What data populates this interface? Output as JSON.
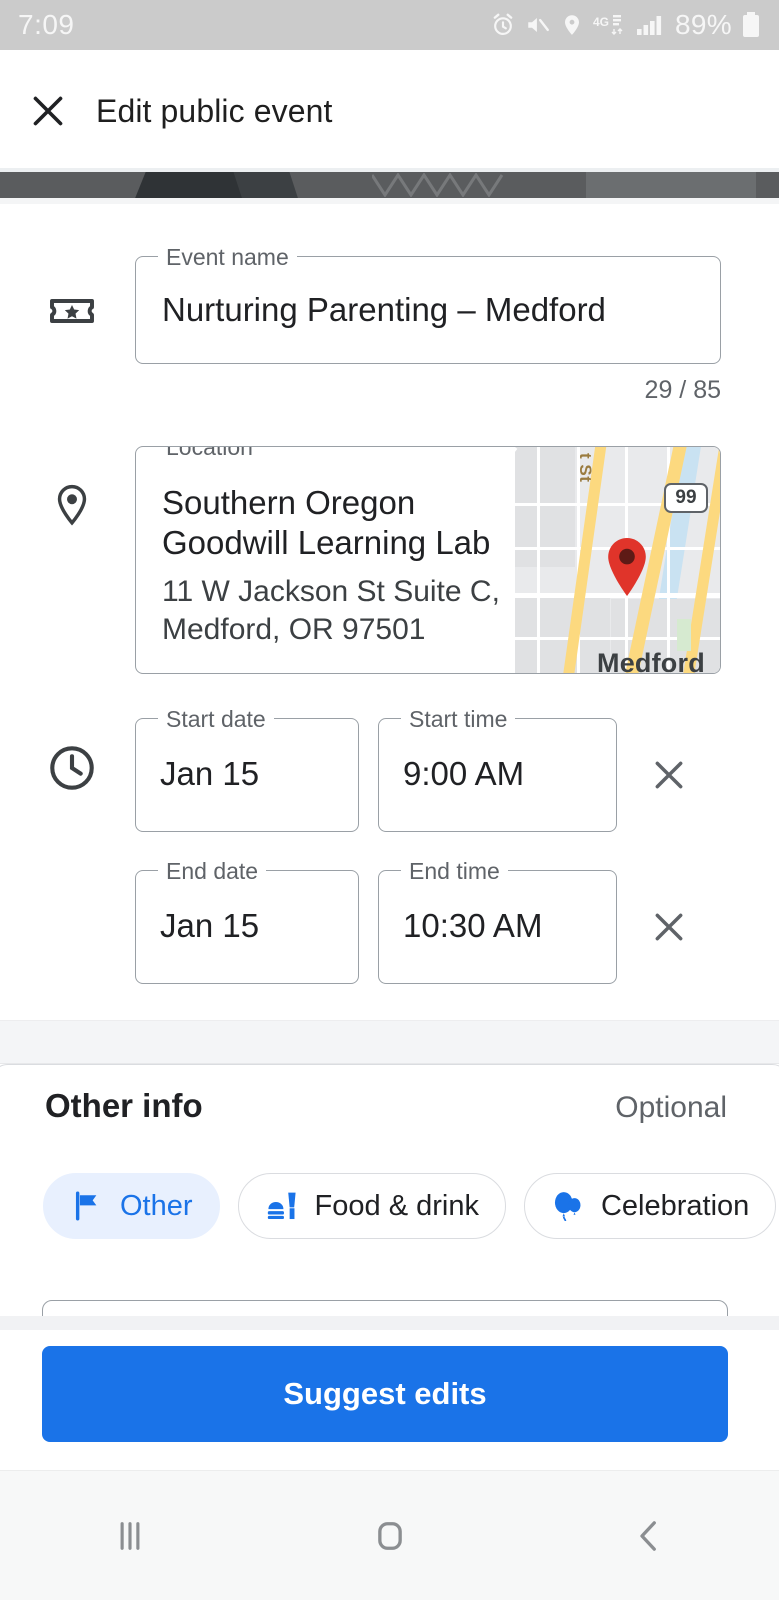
{
  "status_bar": {
    "time": "7:09",
    "battery_percent": "89%",
    "icons": [
      "alarm-icon",
      "mute-icon",
      "location-icon",
      "4g-lte-icon",
      "signal-bars-icon",
      "battery-icon"
    ]
  },
  "app_bar": {
    "close_label": "×",
    "title": "Edit public event",
    "close_icon": "close-icon"
  },
  "form": {
    "event_name": {
      "label": "Event name",
      "value": "Nurturing Parenting – Medford",
      "counter": "29 / 85",
      "icon": "ticket-icon"
    },
    "location": {
      "label": "Location",
      "name": "Southern Oregon Goodwill Learning Lab",
      "address": "11 W Jackson St Suite C, Medford, OR 97501",
      "icon": "location-pin-icon",
      "map": {
        "street_label": "t St",
        "highway_shield": "99",
        "city_label": "Medford",
        "marker_color": "#e0342a",
        "road_color": "#fcd97f"
      }
    },
    "schedule": {
      "icon": "clock-icon",
      "start_date": {
        "label": "Start date",
        "value": "Jan 15"
      },
      "start_time": {
        "label": "Start time",
        "value": "9:00 AM"
      },
      "end_date": {
        "label": "End date",
        "value": "Jan 15"
      },
      "end_time": {
        "label": "End time",
        "value": "10:30 AM"
      },
      "clear_icon": "close-icon"
    }
  },
  "other_info": {
    "title": "Other info",
    "optional_label": "Optional",
    "chips": [
      {
        "label": "Other",
        "icon": "flag-icon",
        "selected": true
      },
      {
        "label": "Food & drink",
        "icon": "food-drink-icon",
        "selected": false
      },
      {
        "label": "Celebration",
        "icon": "balloon-icon",
        "selected": false
      }
    ]
  },
  "footer": {
    "cta_label": "Suggest edits",
    "cta_color": "#1a73e8"
  },
  "nav_bar": {
    "recents_icon": "recents-icon",
    "home_icon": "home-icon",
    "back_icon": "back-icon"
  }
}
